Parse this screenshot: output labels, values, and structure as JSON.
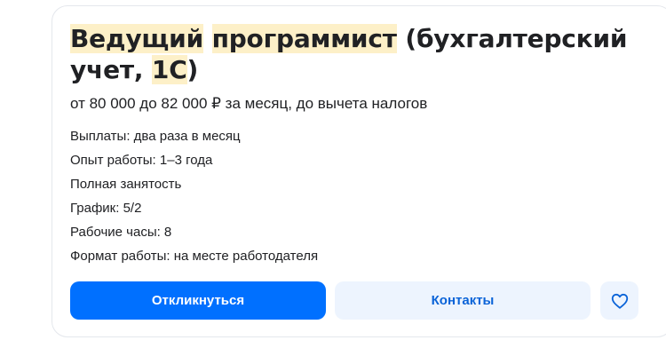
{
  "vacancy": {
    "title_parts": {
      "part1": "Ведущий",
      "part2": "программист",
      "part3": "(бухгалтерский учет,",
      "part4": "1С",
      "part5": ")"
    },
    "salary": "от 80 000 до 82 000 ₽ за месяц, до вычета налогов",
    "facts": [
      "Выплаты: два раза в месяц",
      "Опыт работы: 1–3 года",
      "Полная занятость",
      "График: 5/2",
      "Рабочие часы: 8",
      "Формат работы: на месте работодателя"
    ]
  },
  "actions": {
    "respond_label": "Откликнуться",
    "contacts_label": "Контакты",
    "favorite_icon": "heart-icon"
  },
  "colors": {
    "accent": "#0070ff",
    "secondary_bg": "#edf4fe",
    "secondary_text": "#0a63d8",
    "highlight": "#fdf0c8"
  }
}
